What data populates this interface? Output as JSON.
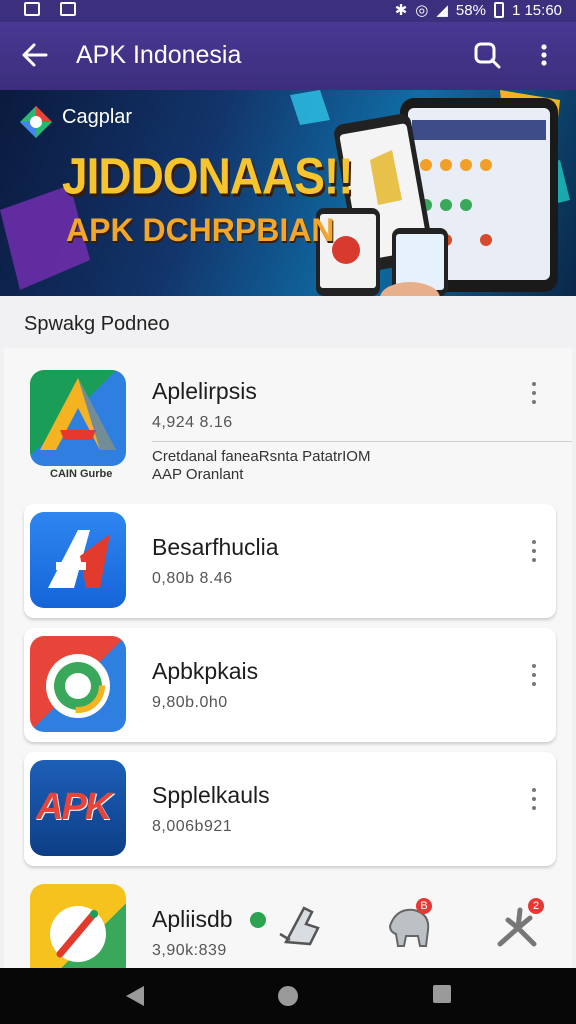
{
  "status_bar": {
    "battery": "58%",
    "time": "1 15:60"
  },
  "app_bar": {
    "title": "APK Indonesia"
  },
  "banner": {
    "brand": "Cagplar",
    "headline": "JIDDONAAS!!",
    "subline": "APK DCHRPBIAN"
  },
  "section": {
    "title": "Spwakg Podneo"
  },
  "apps": [
    {
      "name": "Aplelirpsis",
      "size": "4,924 8.16",
      "icon_caption": "CAIN  Gurbe",
      "description_line1": "Cretdanal faneaRsnta PatatrIOM",
      "description_line2": "AAP Oranlant",
      "icon": "tri-color-a-icon"
    },
    {
      "name": "Besarfhuclia",
      "size": "0,80b 8.46",
      "icon": "blue-a-icon"
    },
    {
      "name": "Apbkpkais",
      "size": "9,80b.0h0",
      "icon": "ring-camera-icon"
    },
    {
      "name": "Spplelkauls",
      "size": "8,006b921",
      "icon": "apk-text-icon"
    },
    {
      "name": "Apliisdb",
      "size": "3,90k:839",
      "icon": "compass-pen-icon"
    }
  ],
  "apk_label": "APK",
  "fab_badges": [
    "B",
    "2"
  ]
}
